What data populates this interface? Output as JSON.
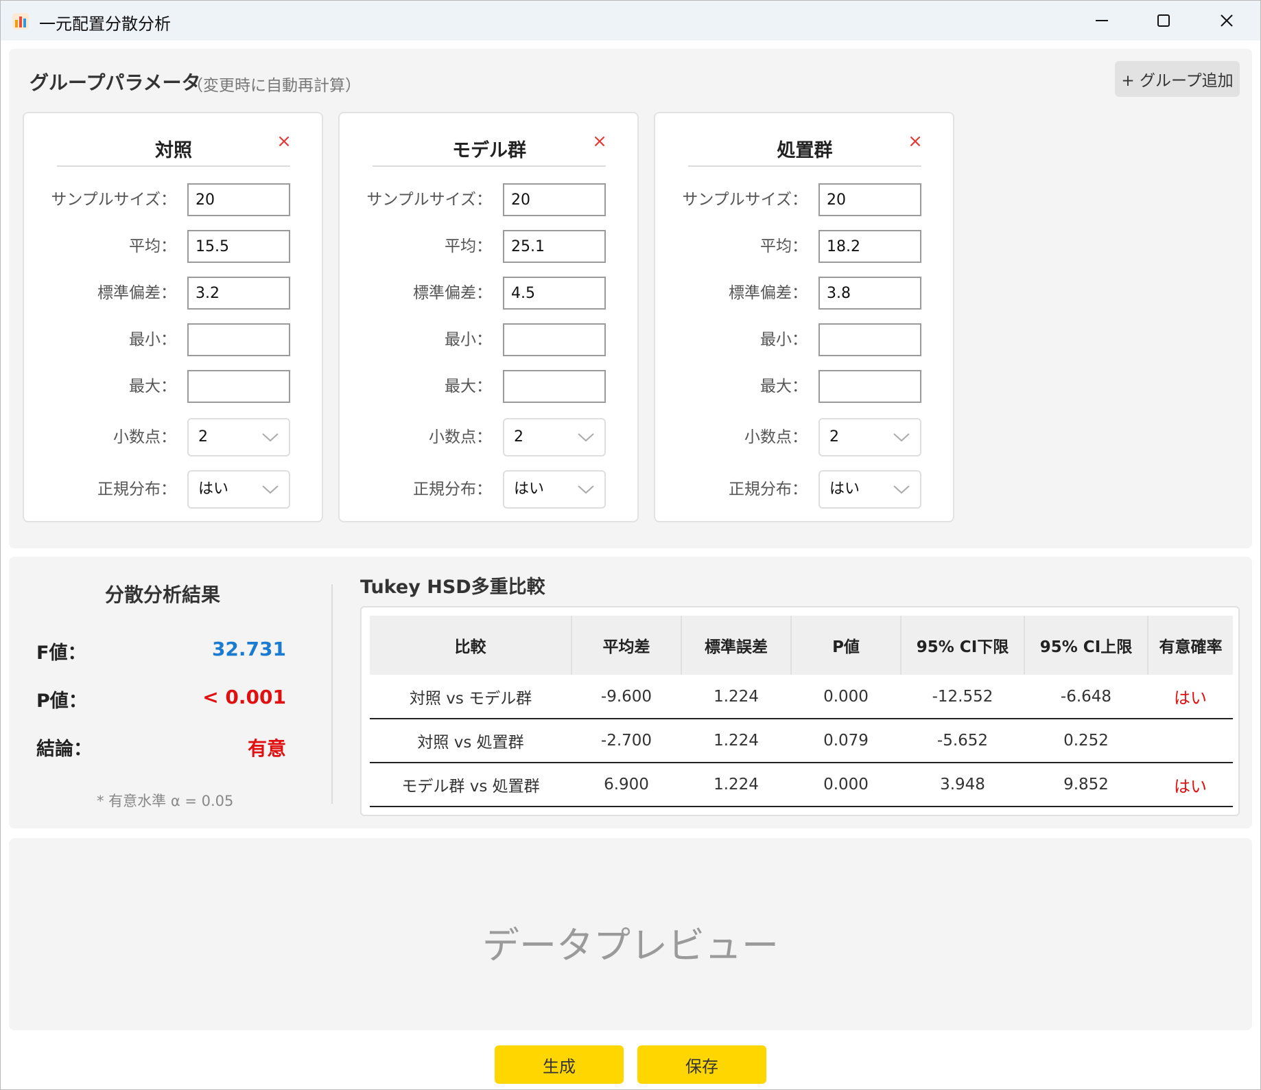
{
  "window": {
    "title": "一元配置分散分析"
  },
  "params": {
    "title": "グループパラメータ",
    "hint": "（変更時に自動再計算）",
    "add_group_label": "+ グループ追加",
    "labels": {
      "sample_size": "サンプルサイズ：",
      "mean": "平均：",
      "sd": "標準偏差：",
      "min": "最小：",
      "max": "最大：",
      "decimals": "小数点：",
      "normal": "正規分布："
    },
    "remove_glyph": "×",
    "groups": [
      {
        "name": "対照",
        "sample_size": "20",
        "mean": "15.5",
        "sd": "3.2",
        "min": "",
        "max": "",
        "decimals": "2",
        "normal": "はい"
      },
      {
        "name": "モデル群",
        "sample_size": "20",
        "mean": "25.1",
        "sd": "4.5",
        "min": "",
        "max": "",
        "decimals": "2",
        "normal": "はい"
      },
      {
        "name": "処置群",
        "sample_size": "20",
        "mean": "18.2",
        "sd": "3.8",
        "min": "",
        "max": "",
        "decimals": "2",
        "normal": "はい"
      }
    ]
  },
  "anova": {
    "title": "分散分析結果",
    "f_label": "F値：",
    "f_value": "32.731",
    "p_label": "P値：",
    "p_value": "< 0.001",
    "conclusion_label": "結論：",
    "conclusion_value": "有意",
    "alpha_note": "* 有意水準 α = 0.05"
  },
  "tukey": {
    "title": "Tukey HSD多重比較",
    "headers": [
      "比較",
      "平均差",
      "標準誤差",
      "P値",
      "95% CI下限",
      "95% CI上限",
      "有意確率"
    ],
    "rows": [
      [
        "対照 vs モデル群",
        "-9.600",
        "1.224",
        "0.000",
        "-12.552",
        "-6.648",
        "はい"
      ],
      [
        "対照 vs 処置群",
        "-2.700",
        "1.224",
        "0.079",
        "-5.652",
        "0.252",
        ""
      ],
      [
        "モデル群 vs 処置群",
        "6.900",
        "1.224",
        "0.000",
        "3.948",
        "9.852",
        "はい"
      ]
    ]
  },
  "preview": {
    "placeholder": "データプレビュー"
  },
  "actions": {
    "generate_label": "生成",
    "save_label": "保存"
  },
  "colors": {
    "accent_blue": "#1a7bd0",
    "alert_red": "#e01010",
    "button_yellow": "#ffd600",
    "remove_red": "#e53935"
  }
}
